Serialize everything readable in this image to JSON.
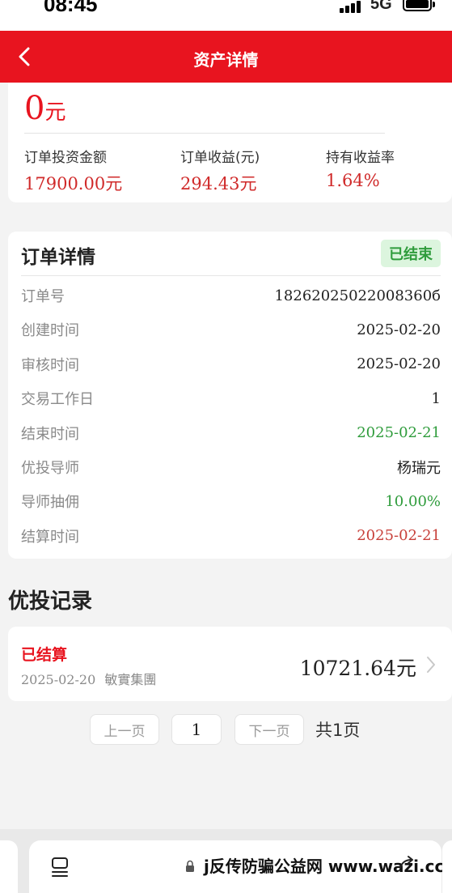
{
  "status_bar": {
    "time": "08:45",
    "network": "5G"
  },
  "header": {
    "title": "资产详情"
  },
  "summary": {
    "total_value": "0",
    "total_unit": "元",
    "stats": [
      {
        "label": "订单投资金额",
        "value": "17900.00元"
      },
      {
        "label": "订单收益(元)",
        "value": "294.43元"
      },
      {
        "label": "持有收益率",
        "value": "1.64%"
      }
    ]
  },
  "order_detail": {
    "title": "订单详情",
    "status": "已结束",
    "rows": [
      {
        "label": "订单号",
        "value": "18262025022008360б"
      },
      {
        "label": "创建时间",
        "value": "2025-02-20"
      },
      {
        "label": "审核时间",
        "value": "2025-02-20"
      },
      {
        "label": "交易工作日",
        "value": "1"
      },
      {
        "label": "结束时间",
        "value": "2025-02-21",
        "color": "#2f9c3c"
      },
      {
        "label": "优投导师",
        "value": "杨瑞元"
      },
      {
        "label": "导师抽佣",
        "value": "10.00%",
        "color": "#2f9c3c"
      },
      {
        "label": "结算时间",
        "value": "2025-02-21",
        "color": "#c8403a"
      }
    ]
  },
  "records": {
    "title": "优投记录",
    "items": [
      {
        "status": "已结算",
        "date": "2025-02-20",
        "company": "敏實集團",
        "amount": "10721.64元"
      }
    ]
  },
  "pagination": {
    "prev_label": "上一页",
    "current_page": "1",
    "next_label": "下一页",
    "total_label": "共1页"
  },
  "browser": {
    "watermark": "j反传防骗公益网 www.wazi.cc"
  },
  "colors": {
    "brand_red": "#e8141f",
    "success_green": "#2f9c3c",
    "value_red": "#d02a2a"
  }
}
